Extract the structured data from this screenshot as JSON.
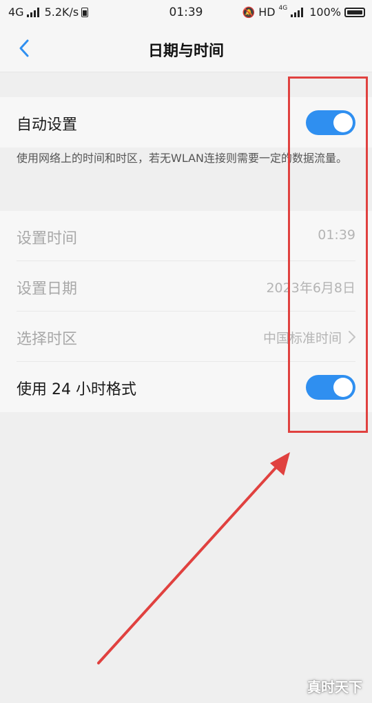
{
  "status_bar": {
    "network": "4G",
    "speed": "5.2K/s",
    "time": "01:39",
    "hd": "HD",
    "hd_net": "4G",
    "battery": "100%"
  },
  "header": {
    "title": "日期与时间"
  },
  "auto_setting": {
    "label": "自动设置",
    "enabled": true,
    "description": "使用网络上的时间和时区，若无WLAN连接则需要一定的数据流量。"
  },
  "settings": {
    "set_time": {
      "label": "设置时间",
      "value": "01:39"
    },
    "set_date": {
      "label": "设置日期",
      "value": "2023年6月8日"
    },
    "timezone": {
      "label": "选择时区",
      "value": "中国标准时间"
    },
    "hour24": {
      "label": "使用 24 小时格式",
      "enabled": true
    }
  },
  "colors": {
    "toggle_on": "#2f8ff0",
    "annotation": "#e0413f",
    "accent_back": "#2f8ff0"
  },
  "watermark": "真时天下"
}
